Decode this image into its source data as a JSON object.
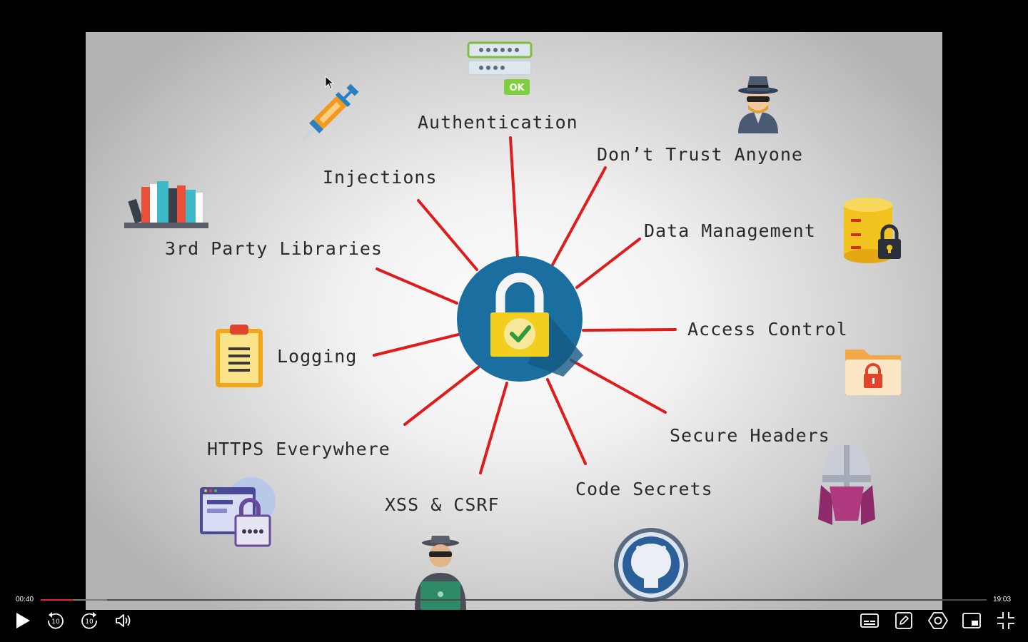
{
  "slide": {
    "labels": {
      "authentication": "Authentication",
      "dont_trust": "Don’t Trust Anyone",
      "injections": "Injections",
      "data_management": "Data Management",
      "third_party": "3rd Party Libraries",
      "access_control": "Access Control",
      "logging": "Logging",
      "secure_headers": "Secure Headers",
      "https": "HTTPS Everywhere",
      "code_secrets": "Code Secrets",
      "xss_csrf": "XSS & CSRF"
    },
    "password_ok": "OK",
    "colors": {
      "ray": "#e01b1b",
      "hub": "#1b6fa0",
      "lock": "#f2cf1e",
      "check": "#2e9a3a"
    }
  },
  "player": {
    "current_time": "00:40",
    "duration": "19:03",
    "progress_fraction": 0.035,
    "buffered_fraction": 0.07,
    "skip_seconds": "10"
  }
}
